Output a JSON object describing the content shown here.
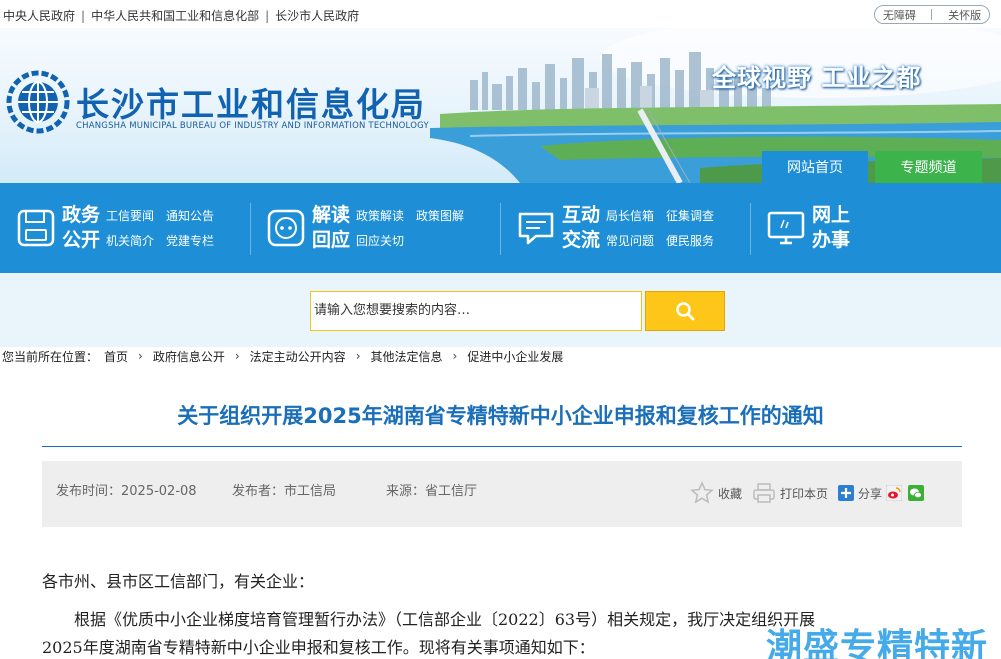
{
  "topbar": {
    "links": [
      "中央人民政府",
      "中华人民共和国工业和信息化部",
      "长沙市人民政府"
    ],
    "accessibility": "无障碍",
    "elder": "关怀版"
  },
  "banner": {
    "title": "长沙市工业和信息化局",
    "subtitle": "CHANGSHA MUNICIPAL BUREAU OF INDUSTRY AND INFORMATION TECHNOLOGY",
    "slogan": "全球视野  工业之都",
    "tab_home": "网站首页",
    "tab_topic": "专题频道"
  },
  "nav": {
    "groups": [
      {
        "title_line1": "政务",
        "title_line2": "公开",
        "icon": "floppy-disk-icon",
        "links": [
          "工信要闻",
          "通知公告",
          "机关简介",
          "党建专栏"
        ]
      },
      {
        "title_line1": "解读",
        "title_line2": "回应",
        "icon": "speech-dots-icon",
        "links": [
          "政策解读",
          "政策图解",
          "回应关切",
          ""
        ]
      },
      {
        "title_line1": "互动",
        "title_line2": "交流",
        "icon": "chat-bubble-icon",
        "links": [
          "局长信箱",
          "征集调查",
          "常见问题",
          "便民服务"
        ]
      },
      {
        "title_line1": "网上",
        "title_line2": "办事",
        "icon": "computer-monitor-icon",
        "links": []
      }
    ]
  },
  "search": {
    "placeholder": "请输入您想要搜索的内容…",
    "button_icon": "search-icon"
  },
  "breadcrumb": {
    "label": "您当前所在位置：",
    "items": [
      "首页",
      "政府信息公开",
      "法定主动公开内容",
      "其他法定信息",
      "促进中小企业发展"
    ]
  },
  "article": {
    "title": "关于组织开展2025年湖南省专精特新中小企业申报和复核工作的通知",
    "publish_time": "发布时间：2025-02-08",
    "publisher": "发布者：市工信局",
    "source": "来源：省工信厅",
    "favorite": "收藏",
    "print": "打印本页",
    "share": "分享",
    "salutation": "各市州、县市区工信部门，有关企业：",
    "para1_line1": "根据《优质中小企业梯度培育管理暂行办法》（工信部企业〔2022〕63号）相关规定，我厅决定组织开展",
    "para1_line2": "2025年度湖南省专精特新中小企业申报和复核工作。现将有关事项通知如下："
  },
  "watermark": "潮盛专精特新",
  "colors": {
    "primary_blue": "#1e8fd6",
    "title_blue": "#1a6fb8",
    "green_tab": "#3cb44b",
    "search_yellow": "#ffc61a"
  }
}
